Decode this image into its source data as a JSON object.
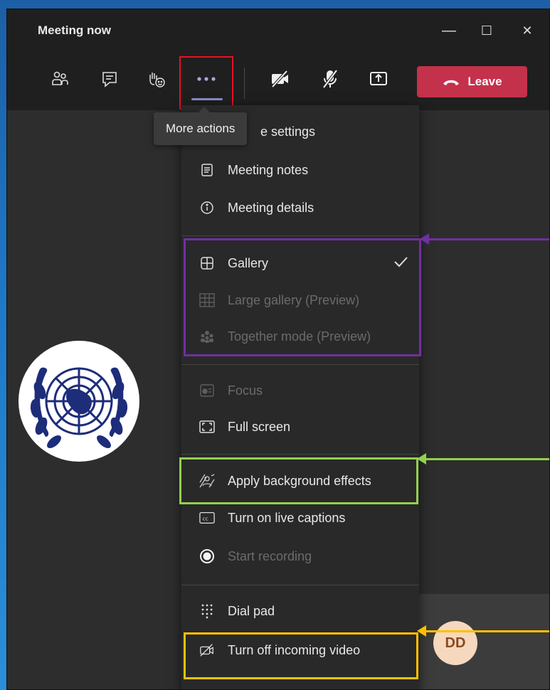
{
  "window": {
    "title": "Meeting now"
  },
  "window_controls": {
    "minimize": "—",
    "maximize": "☐",
    "close": "✕"
  },
  "toolbar": {
    "leave_label": "Leave",
    "tooltip": "More actions"
  },
  "menu": {
    "items": [
      {
        "label": "e settings",
        "icon": "gear-icon",
        "enabled": true
      },
      {
        "label": "Meeting notes",
        "icon": "notes-icon",
        "enabled": true
      },
      {
        "label": "Meeting details",
        "icon": "info-icon",
        "enabled": true
      },
      {
        "label": "Gallery",
        "icon": "gallery-grid-icon",
        "enabled": true,
        "checked": true
      },
      {
        "label": "Large gallery (Preview)",
        "icon": "large-gallery-icon",
        "enabled": false
      },
      {
        "label": "Together mode (Preview)",
        "icon": "together-mode-icon",
        "enabled": false
      },
      {
        "label": "Focus",
        "icon": "focus-icon",
        "enabled": false
      },
      {
        "label": "Full screen",
        "icon": "fullscreen-icon",
        "enabled": true
      },
      {
        "label": "Apply background effects",
        "icon": "background-effects-icon",
        "enabled": true
      },
      {
        "label": "Turn on live captions",
        "icon": "captions-icon",
        "enabled": true
      },
      {
        "label": "Start recording",
        "icon": "record-icon",
        "enabled": false
      },
      {
        "label": "Dial pad",
        "icon": "dialpad-icon",
        "enabled": true
      },
      {
        "label": "Turn off incoming video",
        "icon": "video-off-icon",
        "enabled": true
      }
    ]
  },
  "participant": {
    "initials": "DD"
  },
  "colors": {
    "leave": "#c4314b",
    "highlight_red": "#e81123",
    "highlight_purple": "#7030a0",
    "highlight_green": "#92d050",
    "highlight_yellow": "#ffc000"
  }
}
